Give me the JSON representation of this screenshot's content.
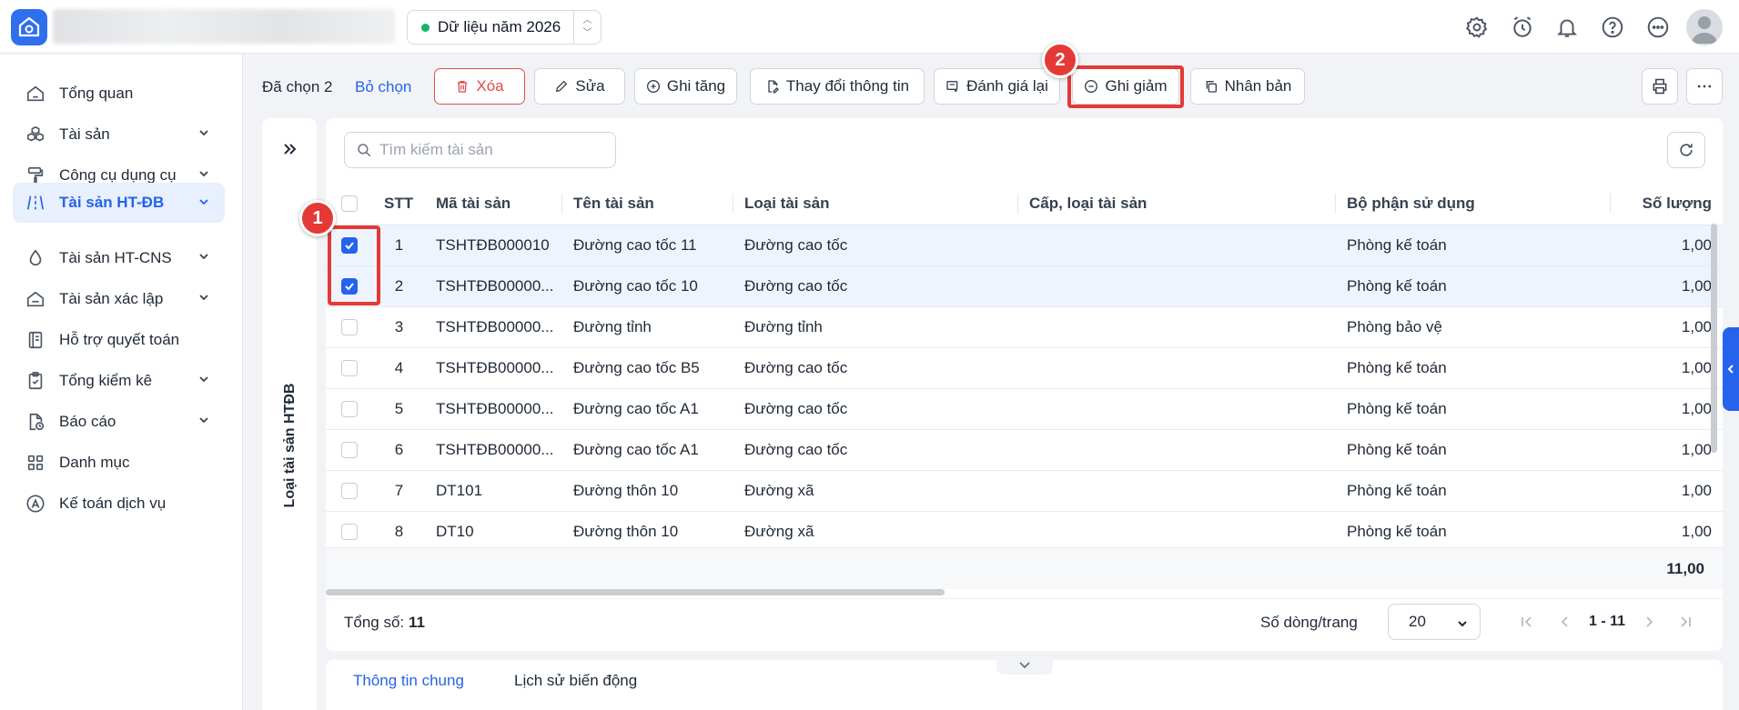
{
  "header": {
    "year_label": "Dữ liệu năm 2026",
    "icons": [
      "settings-icon",
      "alarm-icon",
      "bell-icon",
      "help-icon",
      "more-icon"
    ]
  },
  "sidebar": {
    "items": [
      {
        "label": "Tổng quan",
        "icon": "home-icon",
        "has_children": false,
        "active": false
      },
      {
        "label": "Tài sản",
        "icon": "boxes-icon",
        "has_children": true,
        "active": false
      },
      {
        "label": "Công cụ dụng cụ",
        "icon": "paint-roller-icon",
        "has_children": true,
        "active": false
      },
      {
        "label": "Tài sản HT-ĐB",
        "icon": "road-icon",
        "has_children": true,
        "active": true
      },
      {
        "label": "Tài sản HT-CNS",
        "icon": "water-drop-icon",
        "has_children": true,
        "active": false
      },
      {
        "label": "Tài sản xác lập",
        "icon": "house-icon",
        "has_children": true,
        "active": false
      },
      {
        "label": "Hỗ trợ quyết toán",
        "icon": "notebook-icon",
        "has_children": false,
        "active": false
      },
      {
        "label": "Tổng kiểm kê",
        "icon": "clipboard-icon",
        "has_children": true,
        "active": false
      },
      {
        "label": "Báo cáo",
        "icon": "report-icon",
        "has_children": true,
        "active": false
      },
      {
        "label": "Danh mục",
        "icon": "grid-icon",
        "has_children": false,
        "active": false
      },
      {
        "label": "Kế toán dịch vụ",
        "icon": "accounting-icon",
        "has_children": false,
        "active": false
      }
    ]
  },
  "toolbar": {
    "selected_label": "Đã chọn 2",
    "unselect_label": "Bỏ chọn",
    "delete_label": "Xóa",
    "edit_label": "Sửa",
    "increase_label": "Ghi tăng",
    "change_info_label": "Thay đổi thông tin",
    "revalue_label": "Đánh giá lại",
    "decrease_label": "Ghi giảm",
    "duplicate_label": "Nhân bản"
  },
  "left_panel": {
    "label": "Loại tài sản HTĐB"
  },
  "search": {
    "placeholder": "Tìm kiếm tài sản"
  },
  "table": {
    "columns": [
      "STT",
      "Mã tài sản",
      "Tên tài sản",
      "Loại tài sản",
      "Cấp, loại tài sản",
      "Bộ phận sử dụng",
      "Số lượng"
    ],
    "rows": [
      {
        "checked": true,
        "stt": "1",
        "code": "TSHTĐB000010",
        "name": "Đường cao tốc 11",
        "type": "Đường cao tốc",
        "level": "",
        "dept": "Phòng kế toán",
        "qty": "1,00"
      },
      {
        "checked": true,
        "stt": "2",
        "code": "TSHTĐB00000...",
        "name": "Đường cao tốc 10",
        "type": "Đường cao tốc",
        "level": "",
        "dept": "Phòng kế toán",
        "qty": "1,00"
      },
      {
        "checked": false,
        "stt": "3",
        "code": "TSHTĐB00000...",
        "name": "Đường tỉnh",
        "type": "Đường tỉnh",
        "level": "",
        "dept": "Phòng bảo vệ",
        "qty": "1,00"
      },
      {
        "checked": false,
        "stt": "4",
        "code": "TSHTĐB00000...",
        "name": "Đường cao tốc B5",
        "type": "Đường cao tốc",
        "level": "",
        "dept": "Phòng kế toán",
        "qty": "1,00"
      },
      {
        "checked": false,
        "stt": "5",
        "code": "TSHTĐB00000...",
        "name": "Đường cao tốc A1",
        "type": "Đường cao tốc",
        "level": "",
        "dept": "Phòng kế toán",
        "qty": "1,00"
      },
      {
        "checked": false,
        "stt": "6",
        "code": "TSHTĐB00000...",
        "name": "Đường cao tốc A1",
        "type": "Đường cao tốc",
        "level": "",
        "dept": "Phòng kế toán",
        "qty": "1,00"
      },
      {
        "checked": false,
        "stt": "7",
        "code": "DT101",
        "name": "Đường thôn 10",
        "type": "Đường xã",
        "level": "",
        "dept": "Phòng kế toán",
        "qty": "1,00"
      },
      {
        "checked": false,
        "stt": "8",
        "code": "DT10",
        "name": "Đường thôn 10",
        "type": "Đường xã",
        "level": "",
        "dept": "Phòng kế toán",
        "qty": "1,00"
      }
    ],
    "total_qty": "11,00"
  },
  "footer": {
    "total_label": "Tổng số:",
    "total_value": "11",
    "rows_per_page_label": "Số dòng/trang",
    "rows_per_page": "20",
    "range": "1 - 11"
  },
  "bottom_tabs": {
    "general": "Thông tin chung",
    "history": "Lịch sử biến động"
  },
  "annotations": {
    "badge1": "1",
    "badge2": "2",
    "color": "#e53935"
  },
  "colors": {
    "primary": "#2563eb",
    "active_bg": "#e8effd",
    "danger": "#e53935"
  }
}
